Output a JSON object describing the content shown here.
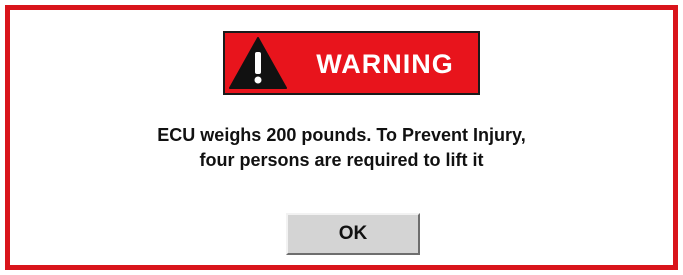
{
  "dialog": {
    "banner_label": "WARNING",
    "banner_icon": "warning-exclamation-icon",
    "message_line1": "ECU weighs 200 pounds. To Prevent Injury,",
    "message_line2": "four persons are required to lift it",
    "ok_label": "OK"
  },
  "colors": {
    "frame": "#d9141b",
    "banner_background": "#e8141c",
    "banner_text": "#ffffff",
    "icon_triangle": "#111111",
    "button_face": "#d4d4d4"
  }
}
